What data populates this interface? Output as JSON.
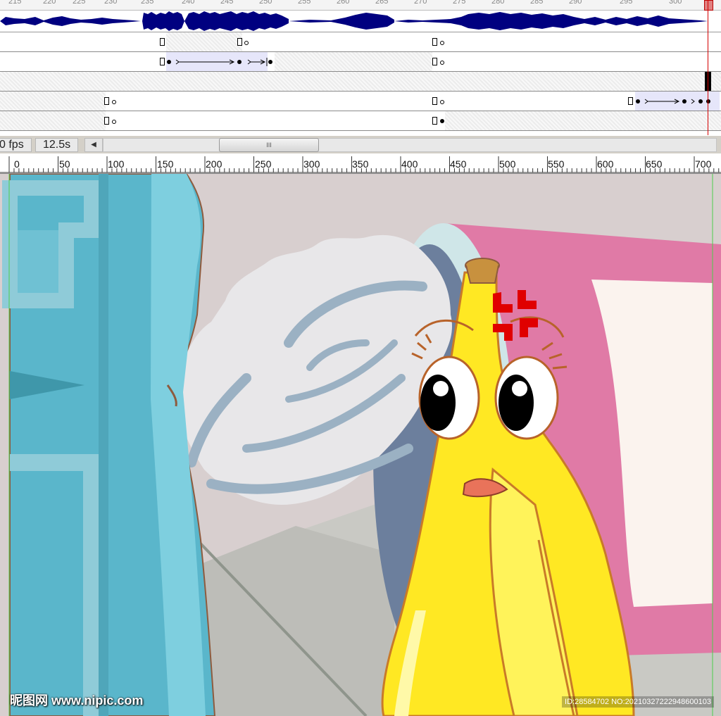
{
  "timeline": {
    "frame_numbers": [
      "215",
      "220",
      "225",
      "230",
      "235",
      "240",
      "245",
      "250",
      "255",
      "260",
      "265",
      "270",
      "275",
      "280",
      "285",
      "290",
      "295",
      "300"
    ]
  },
  "status": {
    "fps_text": "0 fps",
    "time_text": "12.5s",
    "scroll_thumb_label": "III"
  },
  "ruler": {
    "labels": [
      "0",
      "50",
      "100",
      "150",
      "200",
      "250",
      "300",
      "350",
      "400",
      "450",
      "500",
      "550",
      "600",
      "650",
      "700"
    ]
  },
  "watermark": {
    "left": "昵图网 www.nipic.com",
    "right": "ID:28584702 NO:20210327222948600103"
  },
  "colors": {
    "waveform": "#000080",
    "playhead": "#d40000",
    "tween_fill": "#e6e6fa",
    "stage_background": "#d8cfcf",
    "banana_yellow": "#ffe823",
    "cabinet_blue": "#5ab6cb",
    "pink_board": "#e07aa6",
    "anger_mark": "#e00000"
  }
}
